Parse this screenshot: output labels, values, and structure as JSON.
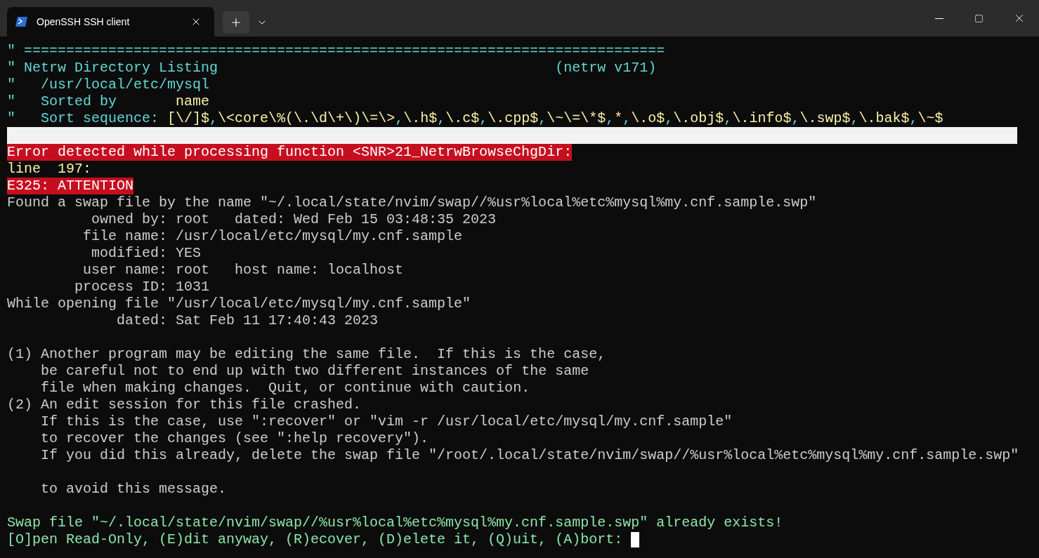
{
  "tab": {
    "title": "OpenSSH SSH client",
    "selected": true
  },
  "lines": [
    {
      "kind": "text",
      "segments": [
        {
          "kind": "comment",
          "text": "\" ============================================================================"
        }
      ]
    },
    {
      "kind": "text",
      "segments": [
        {
          "kind": "comment",
          "text": "\" Netrw Directory Listing"
        },
        {
          "kind": "comment",
          "text": "                                        (netrw v171)"
        }
      ]
    },
    {
      "kind": "text",
      "segments": [
        {
          "kind": "comment",
          "text": "\"   /usr/local/etc/mysql"
        }
      ]
    },
    {
      "kind": "text",
      "segments": [
        {
          "kind": "comment",
          "text": "\"   Sorted by"
        },
        {
          "kind": "value",
          "text": "       name"
        }
      ]
    },
    {
      "kind": "text",
      "segments": [
        {
          "kind": "comment",
          "text": "\"   Sort sequence: "
        },
        {
          "kind": "value",
          "text": "[\\/]$"
        },
        {
          "kind": "comment",
          "text": ","
        },
        {
          "kind": "value",
          "text": "\\<core\\%(\\.\\d\\+\\)\\=\\>"
        },
        {
          "kind": "comment",
          "text": ","
        },
        {
          "kind": "value",
          "text": "\\.h$"
        },
        {
          "kind": "comment",
          "text": ","
        },
        {
          "kind": "value",
          "text": "\\.c$"
        },
        {
          "kind": "comment",
          "text": ","
        },
        {
          "kind": "value",
          "text": "\\.cpp$"
        },
        {
          "kind": "comment",
          "text": ","
        },
        {
          "kind": "value",
          "text": "\\~\\=\\*$"
        },
        {
          "kind": "comment",
          "text": ","
        },
        {
          "kind": "value",
          "text": "*"
        },
        {
          "kind": "comment",
          "text": ","
        },
        {
          "kind": "value",
          "text": "\\.o$"
        },
        {
          "kind": "comment",
          "text": ","
        },
        {
          "kind": "value",
          "text": "\\.obj$"
        },
        {
          "kind": "comment",
          "text": ","
        },
        {
          "kind": "value",
          "text": "\\.info$"
        },
        {
          "kind": "comment",
          "text": ","
        },
        {
          "kind": "value",
          "text": "\\.swp$"
        },
        {
          "kind": "comment",
          "text": ","
        },
        {
          "kind": "value",
          "text": "\\.bak$"
        },
        {
          "kind": "comment",
          "text": ","
        },
        {
          "kind": "value",
          "text": "\\~$"
        }
      ]
    },
    {
      "kind": "cursorline"
    },
    {
      "kind": "text",
      "segments": [
        {
          "kind": "error",
          "text": "Error detected while processing function <SNR>21_NetrwBrowseChgDir:"
        }
      ]
    },
    {
      "kind": "text",
      "segments": [
        {
          "kind": "value",
          "text": "line  197:"
        }
      ]
    },
    {
      "kind": "text",
      "segments": [
        {
          "kind": "error",
          "text": "E325: ATTENTION"
        }
      ]
    },
    {
      "kind": "text",
      "segments": [
        {
          "kind": "normal",
          "text": "Found a swap file by the name \"~/.local/state/nvim/swap//%usr%local%etc%mysql%my.cnf.sample.swp\""
        }
      ]
    },
    {
      "kind": "text",
      "segments": [
        {
          "kind": "normal",
          "text": "          owned by: root   dated: Wed Feb 15 03:48:35 2023"
        }
      ]
    },
    {
      "kind": "text",
      "segments": [
        {
          "kind": "normal",
          "text": "         file name: /usr/local/etc/mysql/my.cnf.sample"
        }
      ]
    },
    {
      "kind": "text",
      "segments": [
        {
          "kind": "normal",
          "text": "          modified: YES"
        }
      ]
    },
    {
      "kind": "text",
      "segments": [
        {
          "kind": "normal",
          "text": "         user name: root   host name: localhost"
        }
      ]
    },
    {
      "kind": "text",
      "segments": [
        {
          "kind": "normal",
          "text": "        process ID: 1031"
        }
      ]
    },
    {
      "kind": "text",
      "segments": [
        {
          "kind": "normal",
          "text": "While opening file \"/usr/local/etc/mysql/my.cnf.sample\""
        }
      ]
    },
    {
      "kind": "text",
      "segments": [
        {
          "kind": "normal",
          "text": "             dated: Sat Feb 11 17:40:43 2023"
        }
      ]
    },
    {
      "kind": "blank"
    },
    {
      "kind": "text",
      "segments": [
        {
          "kind": "normal",
          "text": "(1) Another program may be editing the same file.  If this is the case,"
        }
      ]
    },
    {
      "kind": "text",
      "segments": [
        {
          "kind": "normal",
          "text": "    be careful not to end up with two different instances of the same"
        }
      ]
    },
    {
      "kind": "text",
      "segments": [
        {
          "kind": "normal",
          "text": "    file when making changes.  Quit, or continue with caution."
        }
      ]
    },
    {
      "kind": "text",
      "segments": [
        {
          "kind": "normal",
          "text": "(2) An edit session for this file crashed."
        }
      ]
    },
    {
      "kind": "text",
      "segments": [
        {
          "kind": "normal",
          "text": "    If this is the case, use \":recover\" or \"vim -r /usr/local/etc/mysql/my.cnf.sample\""
        }
      ]
    },
    {
      "kind": "text",
      "segments": [
        {
          "kind": "normal",
          "text": "    to recover the changes (see \":help recovery\")."
        }
      ]
    },
    {
      "kind": "text",
      "segments": [
        {
          "kind": "normal",
          "text": "    If you did this already, delete the swap file \"/root/.local/state/nvim/swap//%usr%local%etc%mysql%my.cnf.sample.swp\""
        }
      ]
    },
    {
      "kind": "blank"
    },
    {
      "kind": "text",
      "segments": [
        {
          "kind": "normal",
          "text": "    to avoid this message."
        }
      ]
    },
    {
      "kind": "blank"
    },
    {
      "kind": "text",
      "segments": [
        {
          "kind": "prompt",
          "text": "Swap file \"~/.local/state/nvim/swap//%usr%local%etc%mysql%my.cnf.sample.swp\" already exists!"
        }
      ]
    },
    {
      "kind": "text",
      "cursor": true,
      "segments": [
        {
          "kind": "prompt",
          "text": "[O]pen Read-Only, (E)dit anyway, (R)ecover, (D)elete it, (Q)uit, (A)bort:"
        }
      ]
    }
  ]
}
